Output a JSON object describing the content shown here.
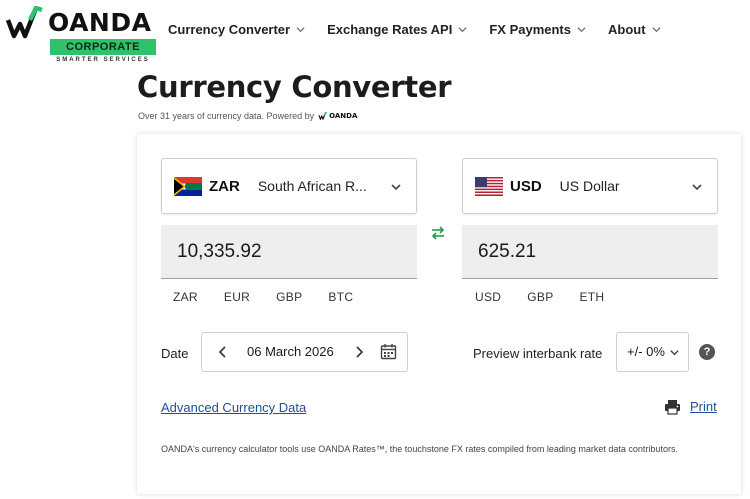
{
  "header": {
    "logo": {
      "word": "OANDA",
      "badge": "CORPORATE",
      "tagline": "SMARTER SERVICES"
    },
    "nav": [
      {
        "label": "Currency Converter"
      },
      {
        "label": "Exchange Rates API"
      },
      {
        "label": "FX Payments"
      },
      {
        "label": "About"
      }
    ]
  },
  "page": {
    "title": "Currency Converter",
    "subtitle": "Over 31 years of currency data. Powered by",
    "powered_logo": "OANDA"
  },
  "converter": {
    "from": {
      "code": "ZAR",
      "name": "South African R...",
      "flag": "south-africa-flag",
      "amount": "10,335.92",
      "quick": [
        "ZAR",
        "EUR",
        "GBP",
        "BTC"
      ]
    },
    "to": {
      "code": "USD",
      "name": "US Dollar",
      "flag": "us-flag",
      "amount": "625.21",
      "quick": [
        "USD",
        "GBP",
        "ETH"
      ]
    },
    "date_label": "Date",
    "date_value": "06 March 2026",
    "preview_label": "Preview interbank rate",
    "interbank_value": "+/- 0%",
    "help_glyph": "?",
    "advanced_link": "Advanced Currency Data",
    "print_link": "Print",
    "disclaimer": "OANDA's currency calculator tools use OANDA Rates™, the touchstone FX rates compiled from leading market data contributors."
  },
  "colors": {
    "brand_green": "#2fc26a",
    "link_blue": "#1d4f9a",
    "swap_green": "#1e9e4a"
  }
}
